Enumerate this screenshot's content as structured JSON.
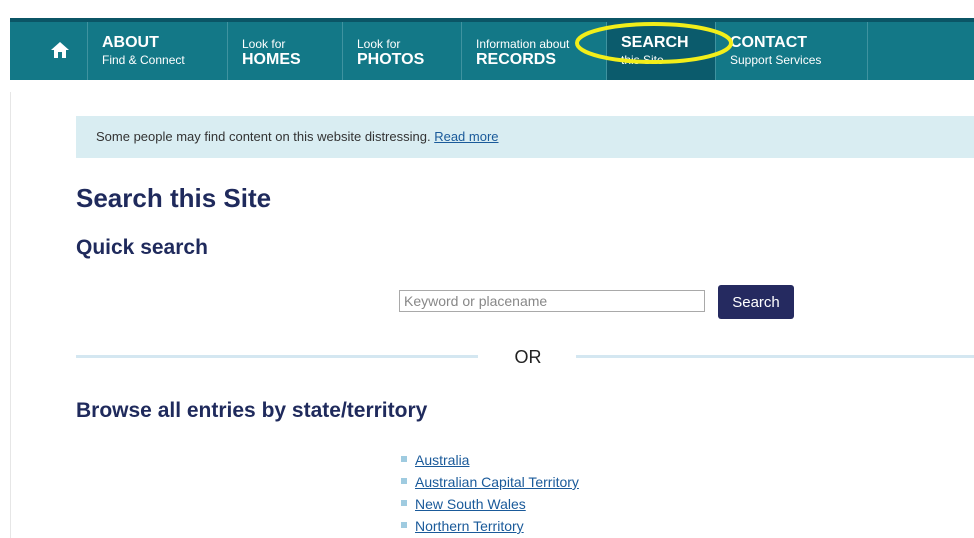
{
  "nav": {
    "home_icon": "home-icon",
    "items": [
      {
        "small": "Find & Connect",
        "big": "ABOUT"
      },
      {
        "small": "Look for",
        "big": "HOMES"
      },
      {
        "small": "Look for",
        "big": "PHOTOS"
      },
      {
        "small": "Information about",
        "big": "RECORDS"
      },
      {
        "small": "this Site",
        "big": "SEARCH"
      },
      {
        "small": "Support Services",
        "big": "CONTACT"
      }
    ],
    "active_index": 4
  },
  "colors": {
    "nav_bg": "#137887",
    "nav_active_bg": "#0b5b6c",
    "heading": "#1f2a5c",
    "notice_bg": "#d9edf2",
    "button_bg": "#252a60",
    "link": "#1a5a9a",
    "highlight_ellipse": "#f2ee1a"
  },
  "notice": {
    "text": "Some people may find content on this website distressing.",
    "link_text": "Read more"
  },
  "page_title": "Search this Site",
  "quick_search": {
    "title": "Quick search",
    "placeholder": "Keyword or placename",
    "value": "",
    "button_label": "Search"
  },
  "divider_text": "OR",
  "browse": {
    "title": "Browse all entries by state/territory",
    "states": [
      "Australia",
      "Australian Capital Territory",
      "New South Wales",
      "Northern Territory"
    ]
  }
}
